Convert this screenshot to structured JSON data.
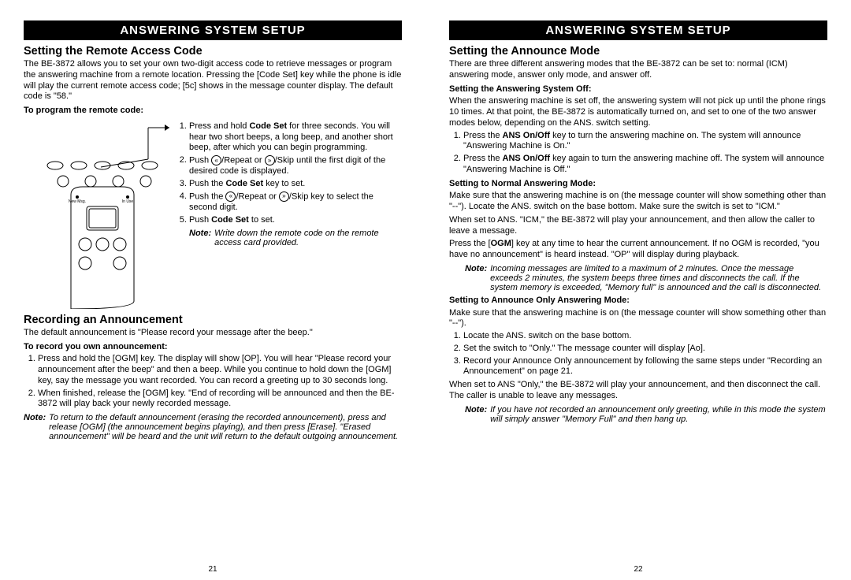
{
  "left": {
    "banner": "ANSWERING SYSTEM SETUP",
    "h_remote": "Setting the Remote Access Code",
    "p_remote": "The BE-3872 allows you to set your own two-digit access code to retrieve messages or program the answering machine from a remote location.  Pressing the [Code Set] key while the phone is idle will play the current remote access code; [5c] shows in the message counter display.  The default code is \"58.\"",
    "sub_program": "To program the remote code:",
    "steps": {
      "s1a": "Press and hold ",
      "s1b": "Code Set",
      "s1c": " for three seconds.  You will hear two short beeps, a long beep, and another short beep, after which you can begin programming.",
      "s2a": "Push ",
      "s2b": "/Repeat or ",
      "s2c": "/Skip until the first digit of the desired code is displayed.",
      "s3a": "Push the ",
      "s3b": "Code Set",
      "s3c": " key to set.",
      "s4a": "Push the ",
      "s4b": "/Repeat or ",
      "s4c": "/Skip key to select the second digit.",
      "s5a": "Push ",
      "s5b": "Code Set",
      "s5c": " to set."
    },
    "note_remote_label": "Note:",
    "note_remote": " Write down the remote code on the remote access card provided.",
    "h_rec": "Recording an Announcement",
    "p_rec": "The default announcement is \"Please record your message after the beep.\"",
    "sub_rec": "To record you own announcement:",
    "rec1": "Press and hold the [OGM] key.  The display will show [OP].  You will hear \"Please record your announcement after the beep\" and then a beep.  While you continue to hold down the [OGM] key, say the message you want recorded.  You can record a greeting up to 30 seconds long.",
    "rec2": "When finished, release the [OGM] key.  \"End of recording will be announced and then the BE-3872 will play back your newly recorded message.",
    "note_rec_label": "Note:",
    "note_rec": " To return to the default announcement (erasing the recorded announcement), press and release [OGM] (the announcement begins playing), and then press [Erase].  \"Erased announcement\" will be heard and the unit will return to the default outgoing announcement.",
    "page": "21"
  },
  "right": {
    "banner": "ANSWERING SYSTEM SETUP",
    "h_announce": "Setting the Announce Mode",
    "p_announce": "There are three different answering modes that the BE-3872 can be set to: normal (ICM) answering mode, answer only mode, and answer off.",
    "sub_off": "Setting the Answering System Off:",
    "p_off": "When the answering machine is set off, the answering system will not pick up until the phone rings 10 times.  At that point, the BE-3872 is automatically turned on, and set to one of the two answer modes below, depending on the ANS. switch setting.",
    "off1a": "Press the ",
    "off1b": "ANS On/Off",
    "off1c": " key to turn the answering machine on.  The system will announce \"Answering Machine is On.\"",
    "off2a": "Press the ",
    "off2b": "ANS On/Off",
    "off2c": " key again to turn the answering machine off.  The system will announce \"Answering Machine is Off.\"",
    "sub_norm": "Setting to Normal Answering Mode:",
    "p_norm": "Make sure that the answering machine is on (the message counter will show something other than \"--\").  Locate the ANS. switch on the base bottom.  Make sure the switch is set to \"ICM.\"",
    "p_norm2": "When set to ANS. \"ICM,\" the BE-3872 will play your announcement, and then allow the caller to leave a message.",
    "p_norm3a": "Press the [",
    "p_norm3b": "OGM",
    "p_norm3c": "] key at any time to hear the current announcement.  If no OGM is recorded, \"you have no announcement\" is heard instead.  \"OP\" will display during playback.",
    "note_norm_label": "Note:",
    "note_norm": " Incoming messages are limited to a maximum of 2 minutes.  Once the message exceeds 2 minutes, the system beeps three times and disconnects the call.  If the system memory is exceeded, \"Memory full\" is announced and the call is disconnected.",
    "sub_ao": "Setting to Announce Only Answering Mode:",
    "p_ao": "Make sure that the answering machine is on (the message counter will show something other than \"--\").",
    "ao1": "Locate the ANS. switch on the base bottom.",
    "ao2": "Set the switch to \"Only.\"  The message counter will display [Ao].",
    "ao3": "Record your Announce Only announcement by following the same steps under \"Recording an Announcement\" on page 21.",
    "p_ao2": "When set to ANS \"Only,\" the BE-3872 will play your announcement, and then disconnect the call.  The caller is unable to leave any messages.",
    "note_ao_label": "Note:",
    "note_ao": " If you have not recorded an announcement only greeting, while in this mode the system will simply answer \"Memory Full\" and then hang up.",
    "page": "22"
  },
  "icons": {
    "rew": "«",
    "fwd": "»"
  }
}
